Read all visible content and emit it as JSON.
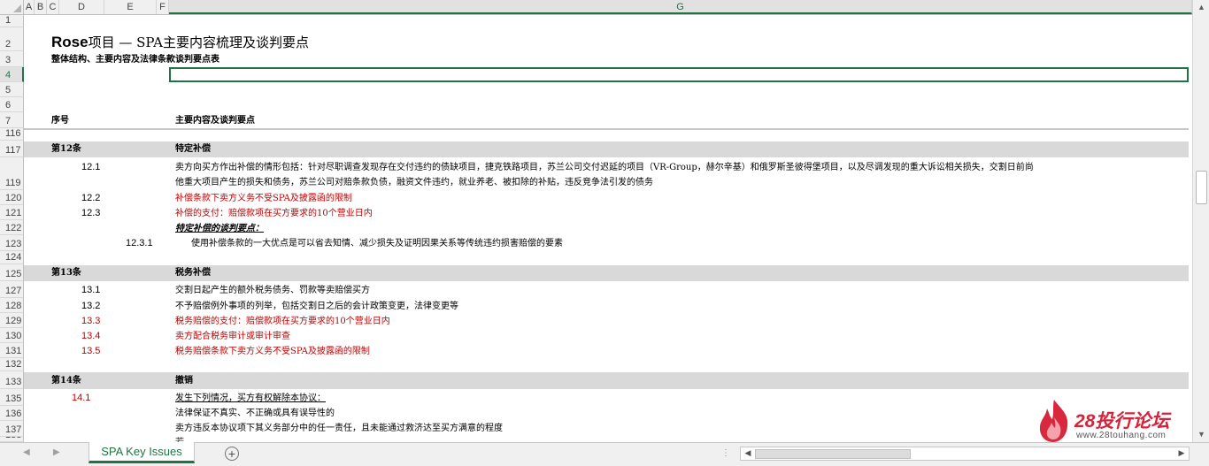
{
  "columns": [
    "A",
    "B",
    "C",
    "D",
    "E",
    "F",
    "G"
  ],
  "selected_column": "G",
  "title_latin": "Rose",
  "title_cjk": "项目 — SPA主要内容梳理及谈判要点",
  "subtitle": "整体结构、主要内容及法律条款谈判要点表",
  "header_no": "序号",
  "header_content": "主要内容及谈判要点",
  "row_numbers": {
    "r1": "1",
    "r2": "2",
    "r3": "3",
    "r4": "4",
    "r5": "5",
    "r6": "6",
    "r7": "7",
    "r116": "116",
    "r117": "117",
    "r119": "119",
    "r120": "120",
    "r121": "121",
    "r122": "122",
    "r123": "123",
    "r124": "124",
    "r125": "125",
    "r127": "127",
    "r128": "128",
    "r129": "129",
    "r130": "130",
    "r131": "131",
    "r132": "132",
    "r133": "133",
    "r135": "135",
    "r136": "136",
    "r137": "137",
    "r138": "138"
  },
  "sections": {
    "s12": {
      "no": "第12条",
      "title": "特定补偿",
      "i1_no": "12.1",
      "i1_line1": "卖方向买方作出补偿的情形包括：针对尽职调查发现存在交付违约的债缺项目，捷克铁路项目，苏兰公司交付迟延的项目（VR-Group，赫尔辛基）和俄罗斯圣彼得堡项目，以及尽调发现的重大诉讼相关损失，交割日前尚",
      "i1_line2": "他重大项目产生的损失和债务，苏兰公司对赔条款负债，融资文件违约，就业养老、被扣除的补贴，违反竞争法引发的债务",
      "i2_no": "12.2",
      "i2_text": "补偿条款下卖方义务不受SPA及披露函的限制",
      "i3_no": "12.3",
      "i3_text": "补偿的支付：赔偿款项在买方要求的10个营业日内",
      "neg_title": "特定补偿的谈判要点：",
      "i31_no": "12.3.1",
      "i31_text": "使用补偿条款的一大优点是可以省去知情、减少损失及证明因果关系等传统违约损害赔偿的要素"
    },
    "s13": {
      "no": "第13条",
      "title": "税务补偿",
      "i1_no": "13.1",
      "i1_text": "交割日起产生的额外税务债务、罚款等卖赔偿买方",
      "i2_no": "13.2",
      "i2_text": "不予赔偿例外事项的列举，包括交割日之后的会计政策变更，法律变更等",
      "i3_no": "13.3",
      "i3_text": "税务赔偿的支付：赔偿款项在买方要求的10个营业日内",
      "i4_no": "13.4",
      "i4_text": "卖方配合税务审计或审计审查",
      "i5_no": "13.5",
      "i5_text": "税务赔偿条款下卖方义务不受SPA及披露函的限制"
    },
    "s14": {
      "no": "第14条",
      "title": "撤销",
      "i1_no": "14.1",
      "i1_text": "发生下列情况，买方有权解除本协议：",
      "l1": "法律保证不真实、不正确或具有误导性的",
      "l2": "卖方违反本协议项下其义务部分中的任一责任，且未能通过救济达至买方满意的程度"
    },
    "row138_partial": "若… … … … … … … … … … … … … … … … … … … … … … … … … … … … … … … …"
  },
  "sheet_tab": "SPA Key Issues",
  "logo": {
    "name": "28投行论坛",
    "url": "www.28touhang.com"
  }
}
